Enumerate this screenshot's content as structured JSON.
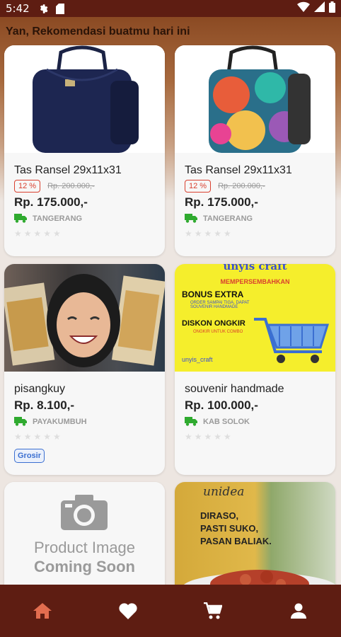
{
  "status_bar": {
    "time": "5:42"
  },
  "greeting": "Yan, Rekomendasi buatmu hari ini",
  "products": [
    {
      "name": "Tas Ransel 29x11x31",
      "discount": "12 %",
      "old_price": "Rp. 200.000,-",
      "price": "Rp. 175.000,-",
      "location": "TANGERANG",
      "rating": 0
    },
    {
      "name": "Tas Ransel 29x11x31",
      "discount": "12 %",
      "old_price": "Rp. 200.000,-",
      "price": "Rp. 175.000,-",
      "location": "TANGERANG",
      "rating": 0
    },
    {
      "name": "pisangkuy",
      "price": "Rp. 8.100,-",
      "location": "PAYAKUMBUH",
      "rating": 0,
      "badge": "Grosir"
    },
    {
      "name": "souvenir handmade",
      "price": "Rp. 100.000,-",
      "location": "KAB SOLOK",
      "rating": 0,
      "image_text": {
        "top": "unyis craft",
        "sub": "MEMPERSEMBAHKAN",
        "bonus": "BONUS EXTRA",
        "bonus_sub": "ORDER SAMPAI TIGA, DAPAT SOUVENIR HANDMADE",
        "diskon": "DISKON ONGKIR",
        "diskon_sub": "ONGKIR UNTUK COMBO",
        "ig": "unyis_craft"
      }
    },
    {
      "name": "",
      "image_text": {
        "line1": "Product Image",
        "line2": "Coming Soon"
      }
    },
    {
      "name": "",
      "image_text": {
        "brand": "unidea",
        "line1": "DIRASO,",
        "line2": "PASTI SUKO,",
        "line3": "PASAN BALIAK."
      }
    }
  ],
  "nav": [
    "home-icon",
    "heart-icon",
    "cart-icon",
    "profile-icon"
  ],
  "colors": {
    "brand": "#5e1d12",
    "discount": "#d9402f",
    "truck": "#2faa2f",
    "badge": "#3b6fd1"
  }
}
